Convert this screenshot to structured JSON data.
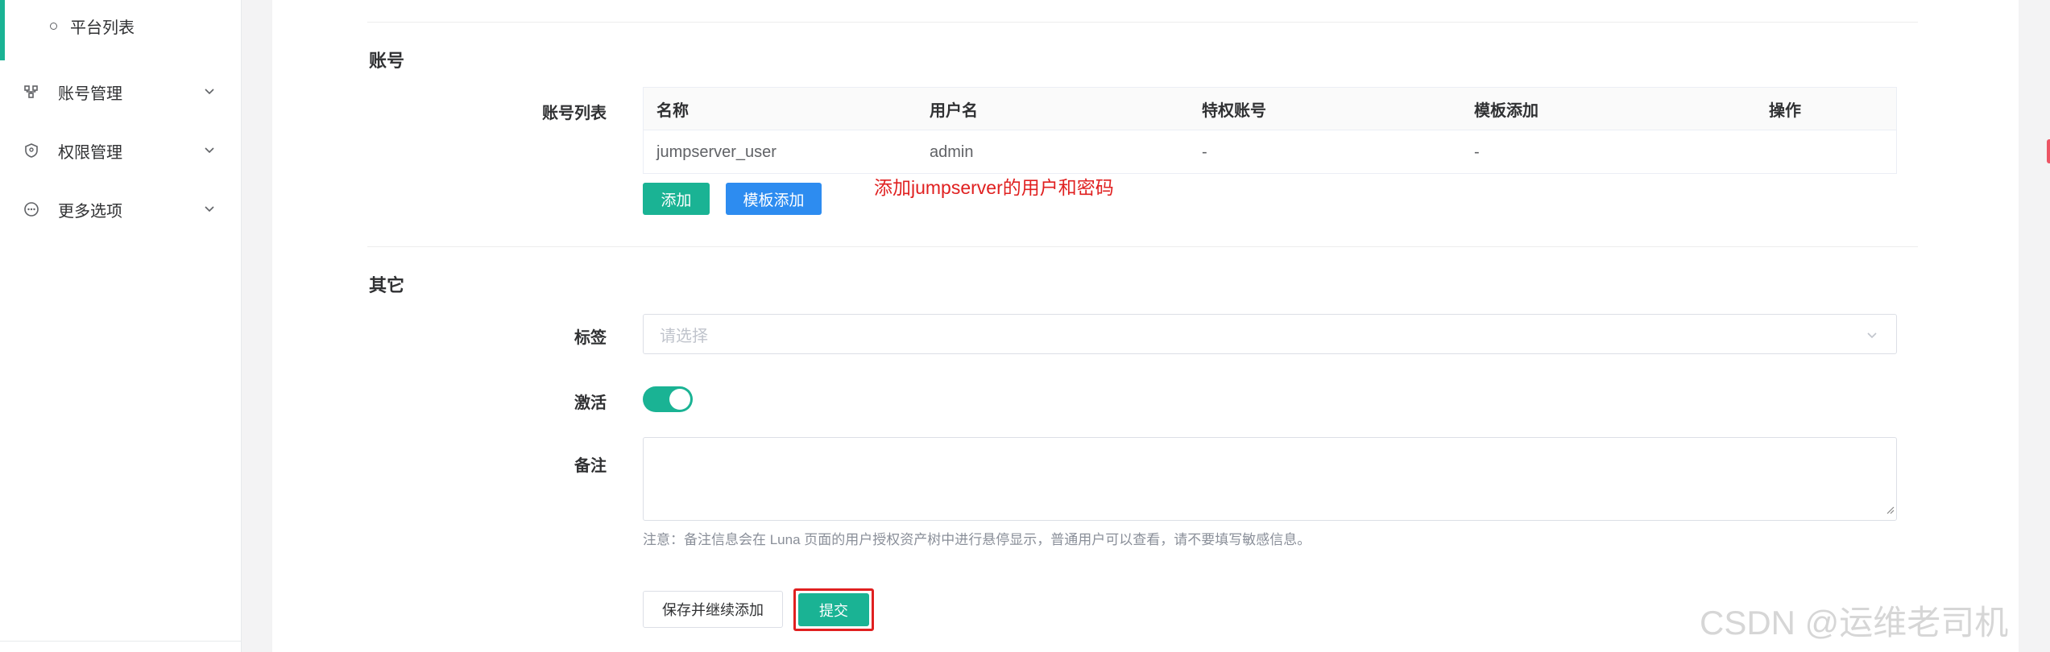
{
  "sidebar": {
    "active_sub_item": "平台列表",
    "items": [
      {
        "label": "账号管理",
        "icon": "account-tree-icon"
      },
      {
        "label": "权限管理",
        "icon": "shield-icon"
      },
      {
        "label": "更多选项",
        "icon": "more-circle-icon"
      }
    ]
  },
  "sections": {
    "account_title": "账号",
    "other_title": "其它"
  },
  "account_list": {
    "label": "账号列表",
    "columns": [
      "名称",
      "用户名",
      "特权账号",
      "模板添加",
      "操作"
    ],
    "rows": [
      {
        "name": "jumpserver_user",
        "username": "admin",
        "privileged": "-",
        "template": "-"
      }
    ],
    "add_button": "添加",
    "template_add_button": "模板添加"
  },
  "annotation": "添加jumpserver的用户和密码",
  "form": {
    "tags_label": "标签",
    "tags_placeholder": "请选择",
    "active_label": "激活",
    "active_on": true,
    "comment_label": "备注",
    "comment_value": "",
    "comment_note": "注意：备注信息会在 Luna 页面的用户授权资产树中进行悬停显示，普通用户可以查看，请不要填写敏感信息。"
  },
  "buttons": {
    "save_continue": "保存并继续添加",
    "submit": "提交"
  },
  "watermark": "CSDN @运维老司机",
  "colors": {
    "primary": "#1ab394",
    "info": "#2d8cf0",
    "danger": "#ed5565",
    "highlight": "#e02020"
  }
}
